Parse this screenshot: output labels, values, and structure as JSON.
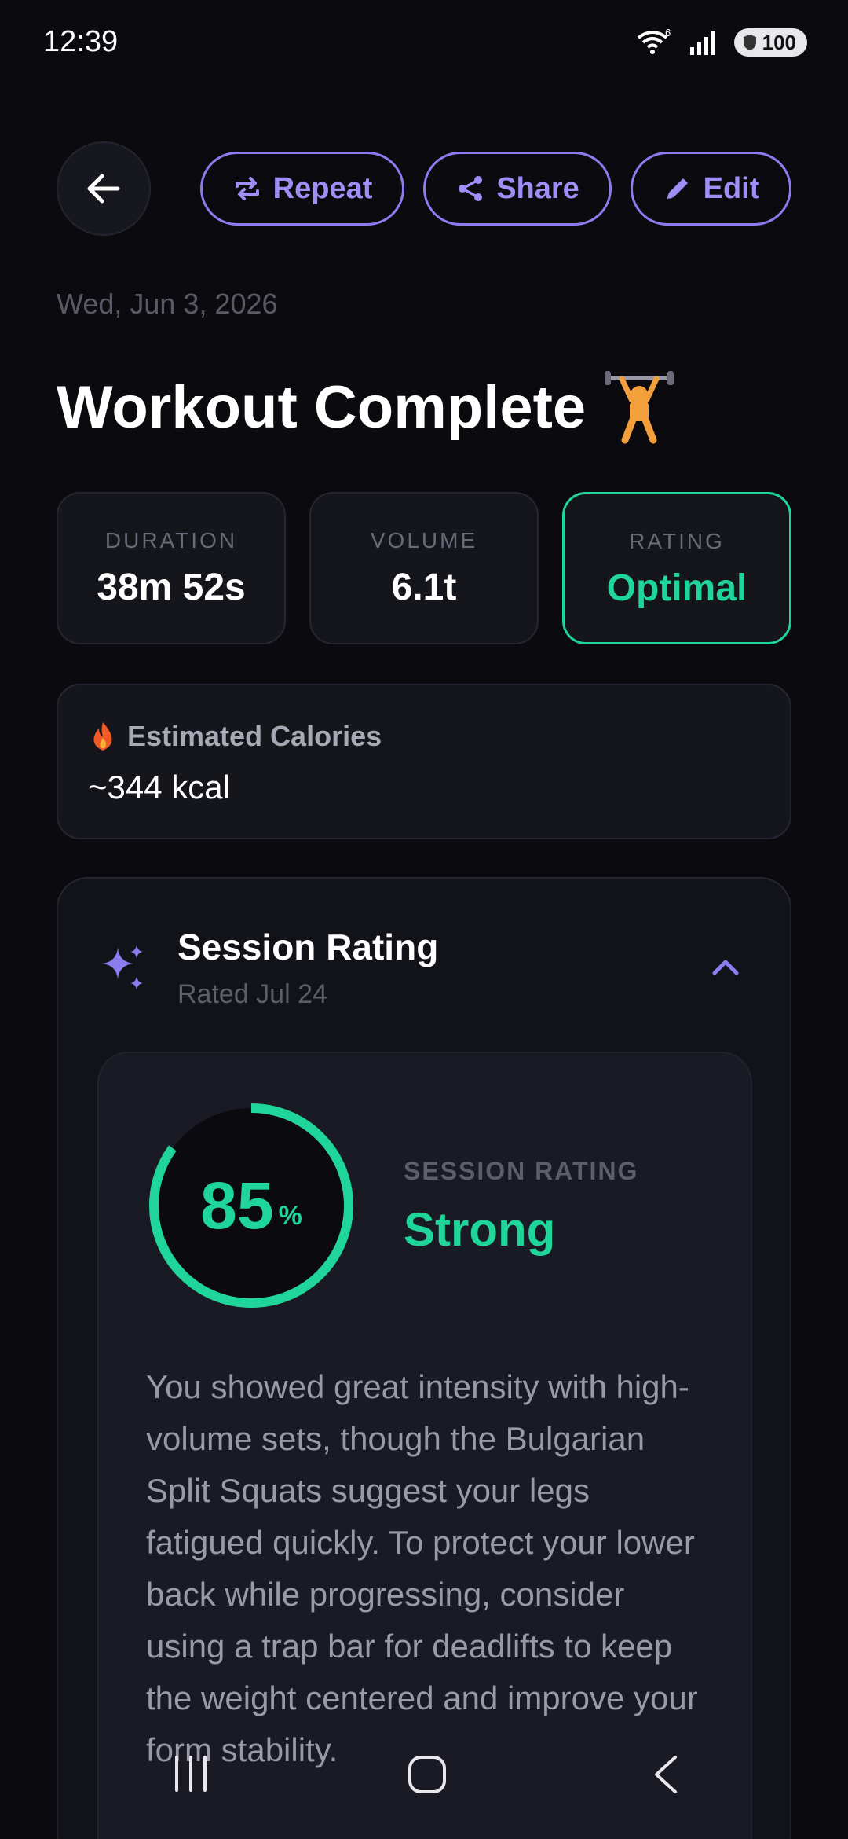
{
  "status_bar": {
    "time": "12:39",
    "wifi_superscript": "6",
    "battery": "100"
  },
  "header": {
    "back_icon": "arrow-left-icon",
    "repeat_label": "Repeat",
    "share_label": "Share",
    "edit_label": "Edit",
    "date": "Wed, Jun 3, 2026",
    "title": "Workout Complete",
    "title_emoji": "weightlifter-icon"
  },
  "stats": [
    {
      "label": "DURATION",
      "value": "38m 52s"
    },
    {
      "label": "VOLUME",
      "value": "6.1t"
    },
    {
      "label": "RATING",
      "value": "Optimal"
    }
  ],
  "calories": {
    "label": "Estimated Calories",
    "value": "~344 kcal"
  },
  "session": {
    "title": "Session Rating",
    "subtitle": "Rated Jul 24",
    "score": "85",
    "score_unit": "%",
    "score_fraction": 0.85,
    "rating_label": "SESSION RATING",
    "rating_value": "Strong",
    "summary": "You showed great intensity with high-volume sets, though the Bulgarian Split Squats suggest your legs fatigued quickly. To protect your lower back while progressing, consider using a trap bar for deadlifts to keep the weight centered and improve your form stability."
  },
  "colors": {
    "accent": "#8b7cf0",
    "success": "#1fd59a",
    "background": "#0b0b0f"
  }
}
